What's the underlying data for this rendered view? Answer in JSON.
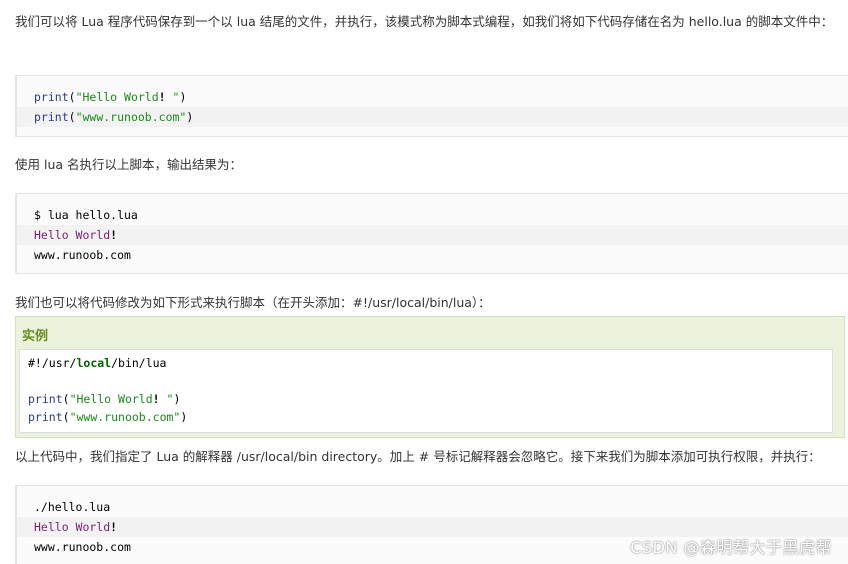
{
  "para1": "我们可以将 Lua 程序代码保存到一个以 lua 结尾的文件，并执行，该模式称为脚本式编程，如我们将如下代码存储在名为 hello.lua 的脚本文件中：",
  "code1": {
    "line1": {
      "fn": "print",
      "open": "(",
      "str": "\"Hello World",
      "bang": "!",
      "str_end": " \"",
      "close": ")"
    },
    "line2": {
      "fn": "print",
      "open": "(",
      "str": "\"www.runoob.com\"",
      "close": ")"
    }
  },
  "para2": "使用 lua 名执行以上脚本，输出结果为：",
  "output1": {
    "cmd": "$ lua hello.lua",
    "hello": "Hello World",
    "bang": "!",
    "site": "www.runoob.com"
  },
  "para3": "我们也可以将代码修改为如下形式来执行脚本（在开头添加：#!/usr/local/bin/lua）：",
  "example": {
    "title": "实例",
    "shebang_pre": "#!/usr/",
    "shebang_local": "local",
    "shebang_post": "/bin/lua",
    "line1": {
      "fn": "print",
      "open": "(",
      "str": "\"Hello World",
      "bang": "!",
      "str_end": " \"",
      "close": ")"
    },
    "line2": {
      "fn": "print",
      "open": "(",
      "str": "\"www.runoob.com\"",
      "close": ")"
    }
  },
  "para4": "以上代码中，我们指定了 Lua 的解释器 /usr/local/bin directory。加上 # 号标记解释器会忽略它。接下来我们为脚本添加可执行权限，并执行：",
  "output2": {
    "cmd": "./hello.lua",
    "hello": "Hello World",
    "bang": "!",
    "site": "www.runoob.com"
  },
  "watermark": "CSDN @森明帮大于黑虎帮",
  "colors": {
    "example_bg": "#ebf2dd",
    "example_title": "#6b8e23",
    "print_keyword": "#2b3a8a",
    "string": "#1a8a1a",
    "output_text": "#7a1f6e"
  }
}
